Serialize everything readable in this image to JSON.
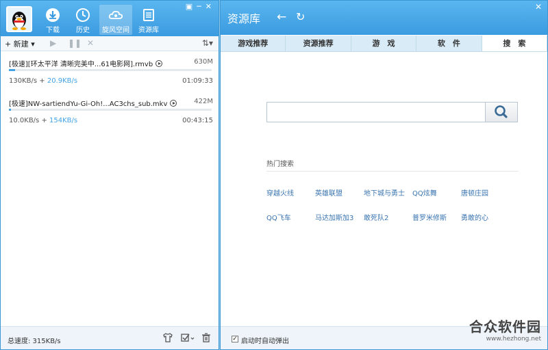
{
  "left": {
    "nav": [
      {
        "label": "下载",
        "icon": "download-icon"
      },
      {
        "label": "历史",
        "icon": "history-icon"
      },
      {
        "label": "旋风空间",
        "icon": "cloud-icon"
      },
      {
        "label": "资源库",
        "icon": "library-icon"
      }
    ],
    "toolbar": {
      "new_label": "+ 新建 ▾",
      "sort_label": "⇅▾"
    },
    "downloads": [
      {
        "name": "[极速][环太平洋 清晰完美中...61电影网].rmvb",
        "size": "630M",
        "progress": 0.03,
        "speed": "130KB/s",
        "boost": "20.9KB/s",
        "time": "01:09:33"
      },
      {
        "name": "[极速]NW-sartiendYu-Gi-Oh!...AC3chs_sub.mkv",
        "size": "422M",
        "progress": 0.01,
        "speed": "10.0KB/s",
        "boost": "154KB/s",
        "time": "00:43:15"
      }
    ],
    "status": {
      "total_speed": "总速度: 315KB/s"
    }
  },
  "right": {
    "title": "资源库",
    "tabs": [
      "游戏推荐",
      "资源推荐",
      "游　戏",
      "软　件",
      "搜　索"
    ],
    "active_tab": 4,
    "search": {
      "value": "",
      "placeholder": ""
    },
    "hot_title": "热门搜索",
    "hot_searches": [
      "穿越火线",
      "英雄联盟",
      "地下城与勇士",
      "QQ炫舞",
      "唐顿庄园",
      "QQ飞车",
      "马达加斯加3",
      "敢死队2",
      "普罗米修斯",
      "勇敢的心"
    ],
    "auto_popup_label": "启动时自动弹出",
    "auto_popup_checked": "✓"
  },
  "watermark": {
    "main": "合众软件园",
    "sub": "www.hezhong.net"
  },
  "colors": {
    "header_blue": "#3b9be0",
    "progress_blue": "#42a2e4",
    "link_blue": "#3a75b0"
  }
}
